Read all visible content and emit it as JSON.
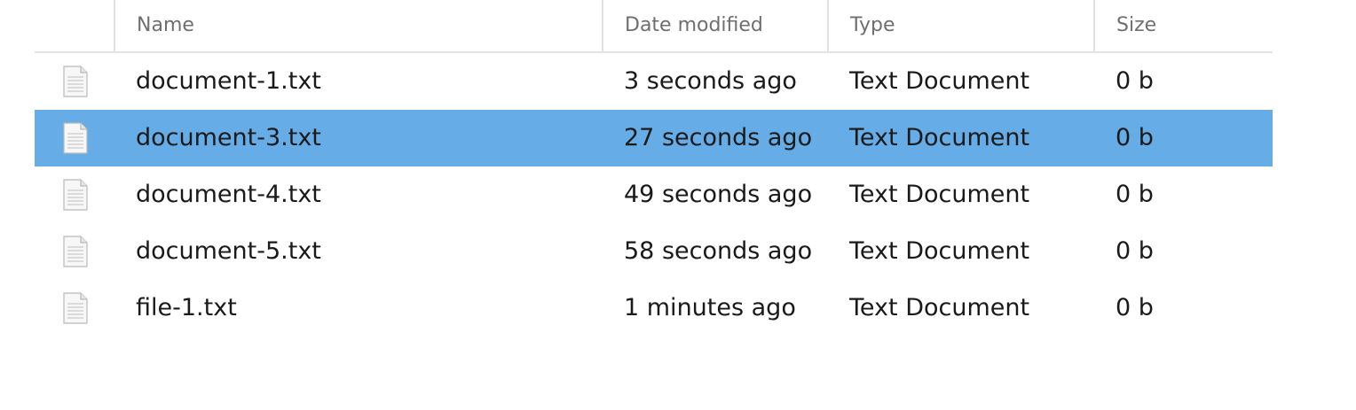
{
  "columns": {
    "name": "Name",
    "date": "Date modified",
    "type": "Type",
    "size": "Size"
  },
  "colors": {
    "selection": "#66ACE6",
    "header_text": "#6F6F6F",
    "divider": "#E4E4E4"
  },
  "files": [
    {
      "name": "document-1.txt",
      "date": "3 seconds ago",
      "type": "Text Document",
      "size": "0 b",
      "icon": "text-file-icon",
      "selected": false
    },
    {
      "name": "document-3.txt",
      "date": "27 seconds ago",
      "type": "Text Document",
      "size": "0 b",
      "icon": "text-file-icon",
      "selected": true
    },
    {
      "name": "document-4.txt",
      "date": "49 seconds ago",
      "type": "Text Document",
      "size": "0 b",
      "icon": "text-file-icon",
      "selected": false
    },
    {
      "name": "document-5.txt",
      "date": "58 seconds ago",
      "type": "Text Document",
      "size": "0 b",
      "icon": "text-file-icon",
      "selected": false
    },
    {
      "name": "file-1.txt",
      "date": "1 minutes ago",
      "type": "Text Document",
      "size": "0 b",
      "icon": "text-file-icon",
      "selected": false
    }
  ]
}
